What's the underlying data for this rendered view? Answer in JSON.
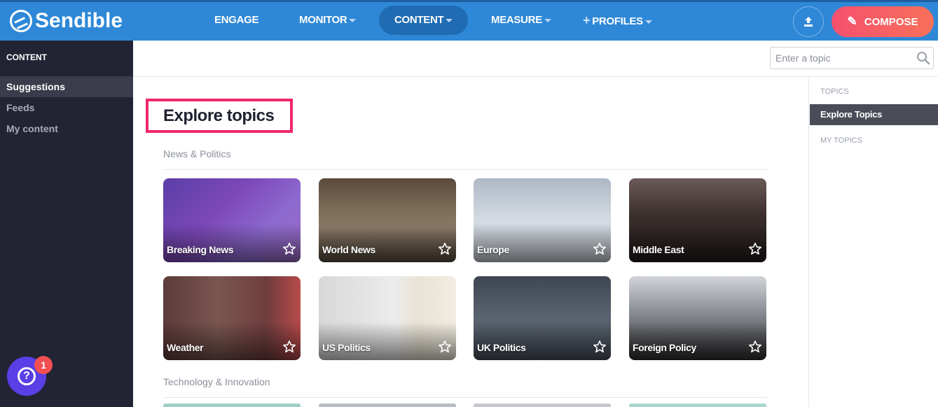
{
  "header": {
    "logo": "Sendible",
    "nav": [
      {
        "label": "ENGAGE"
      },
      {
        "label": "MONITOR"
      },
      {
        "label": "CONTENT"
      },
      {
        "label": "MEASURE"
      },
      {
        "label": "PROFILES"
      }
    ],
    "compose_label": "COMPOSE",
    "accent_color": "#2e88d7",
    "compose_color": "#f5506f"
  },
  "sidebar": {
    "heading": "CONTENT",
    "items": [
      {
        "label": "Suggestions",
        "active": true
      },
      {
        "label": "Feeds",
        "active": false
      },
      {
        "label": "My content",
        "active": false
      }
    ],
    "help_badge": "1"
  },
  "search": {
    "placeholder": "Enter a topic"
  },
  "right_panel": {
    "topics_heading": "TOPICS",
    "explore_item": "Explore Topics",
    "my_topics_heading": "MY TOPICS"
  },
  "main": {
    "title": "Explore topics",
    "sections": [
      {
        "label": "News & Politics",
        "cards": [
          {
            "label": "Breaking News"
          },
          {
            "label": "World News"
          },
          {
            "label": "Europe"
          },
          {
            "label": "Middle East"
          },
          {
            "label": "Weather"
          },
          {
            "label": "US Politics"
          },
          {
            "label": "UK Politics"
          },
          {
            "label": "Foreign Policy"
          }
        ]
      },
      {
        "label": "Technology & Innovation"
      }
    ]
  }
}
